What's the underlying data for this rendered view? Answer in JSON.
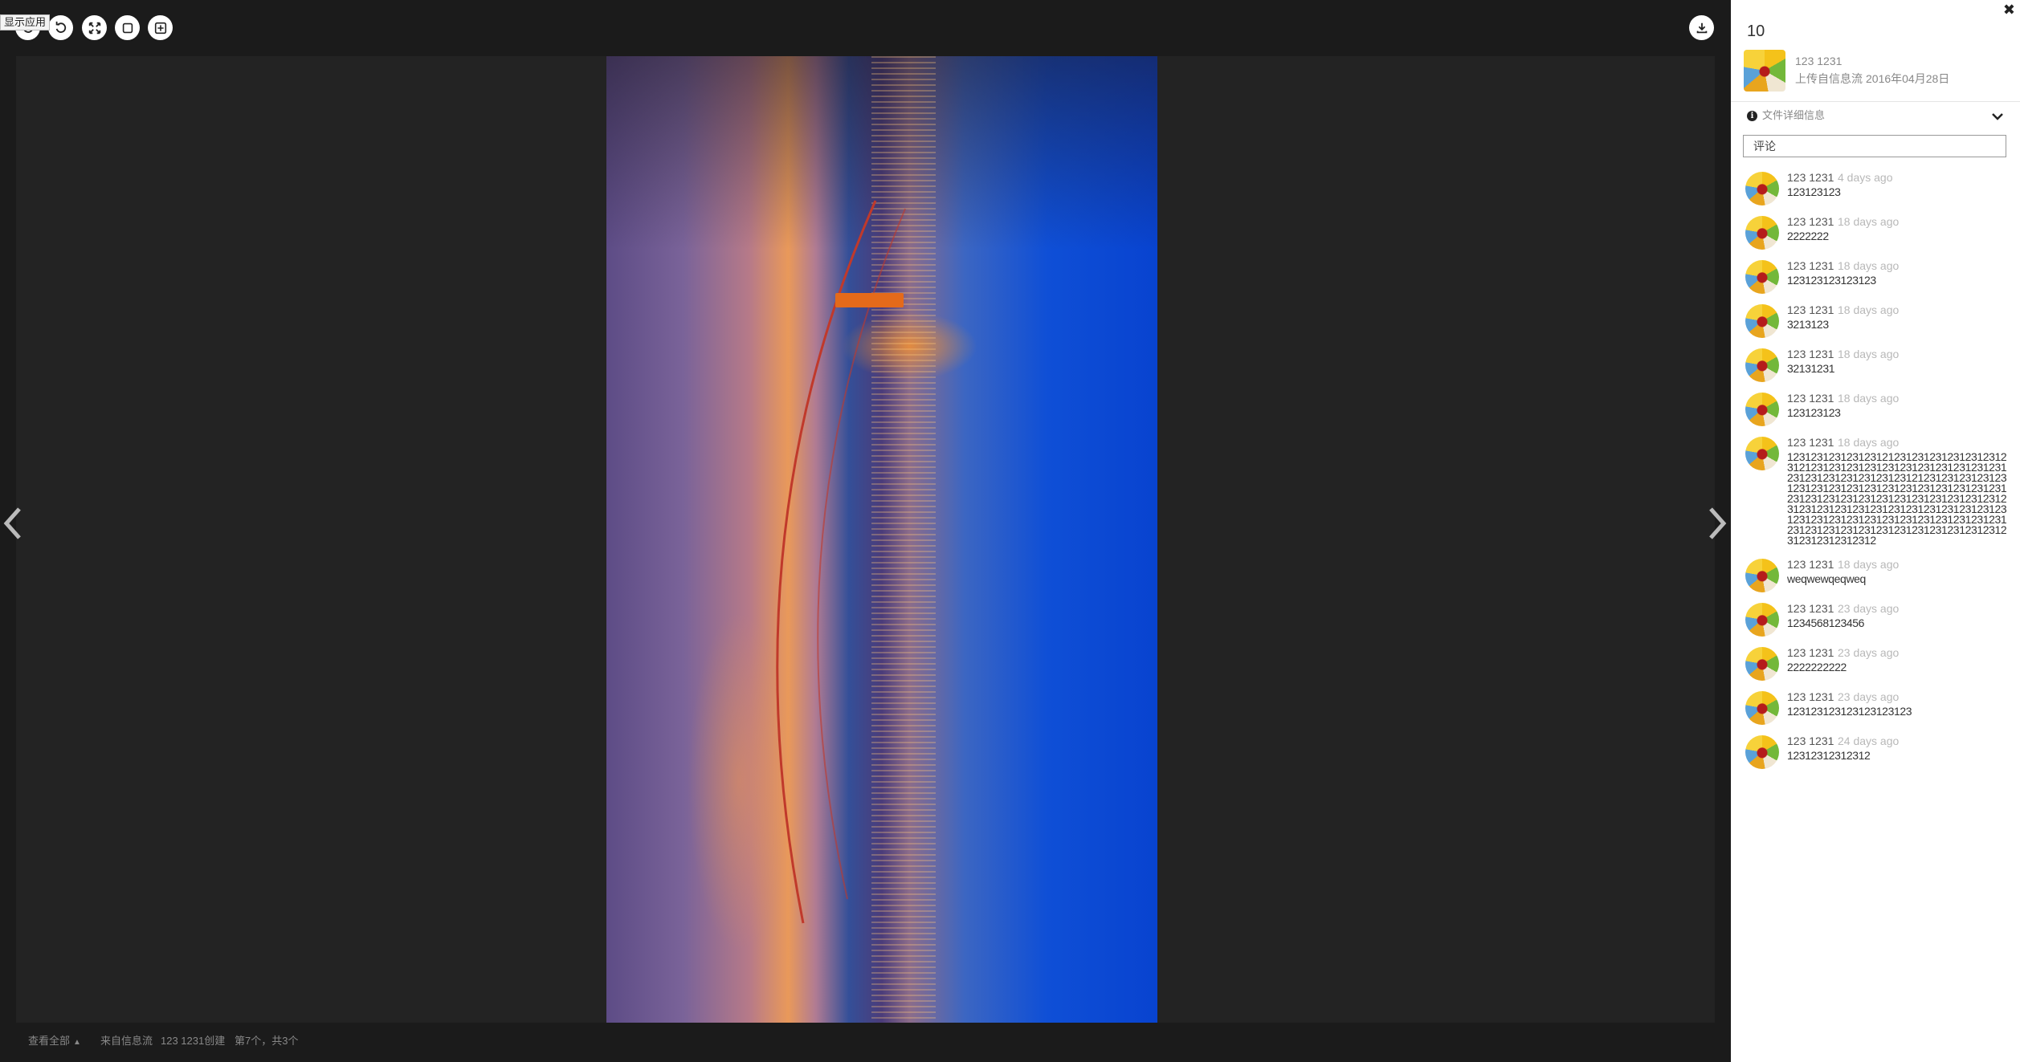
{
  "toolbar": {
    "tooltip": "显示应用",
    "buttons": [
      "refresh",
      "rotate",
      "fullscreen",
      "original-size",
      "fit-screen"
    ],
    "download": "download"
  },
  "footer": {
    "view_all": "查看全部",
    "source": "来自信息流",
    "creator": "123 1231创建",
    "position": "第7个，共3个"
  },
  "panel": {
    "title": "10",
    "uploader": {
      "name": "123 1231",
      "source": "上传自信息流",
      "date": "2016年04月28日"
    },
    "details_label": "文件详细信息",
    "comment_placeholder": "评论",
    "comments": [
      {
        "name": "123 1231",
        "time": "4 days ago",
        "text": "123123123"
      },
      {
        "name": "123 1231",
        "time": "18 days ago",
        "text": "2222222"
      },
      {
        "name": "123 1231",
        "time": "18 days ago",
        "text": "123123123123123"
      },
      {
        "name": "123 1231",
        "time": "18 days ago",
        "text": "3213123"
      },
      {
        "name": "123 1231",
        "time": "18 days ago",
        "text": "32131231"
      },
      {
        "name": "123 1231",
        "time": "18 days ago",
        "text": "123123123"
      },
      {
        "name": "123 1231",
        "time": "18 days ago",
        "text": "12312312312312312123123123123123123123121231231231231231231231231231231231231231231231231231231212312312312312312312312312312312312312312312312312312312312312312312312312312312312312312312312312312312312312312312312312312312312312312312312312312312312312312312312312312312312312312312312312312312312312312312312"
      },
      {
        "name": "123 1231",
        "time": "18 days ago",
        "text": "weqwewqeqweq"
      },
      {
        "name": "123 1231",
        "time": "23 days ago",
        "text": "1234568123456"
      },
      {
        "name": "123 1231",
        "time": "23 days ago",
        "text": "2222222222"
      },
      {
        "name": "123 1231",
        "time": "23 days ago",
        "text": "123123123123123123123"
      },
      {
        "name": "123 1231",
        "time": "24 days ago",
        "text": "12312312312312"
      }
    ]
  }
}
